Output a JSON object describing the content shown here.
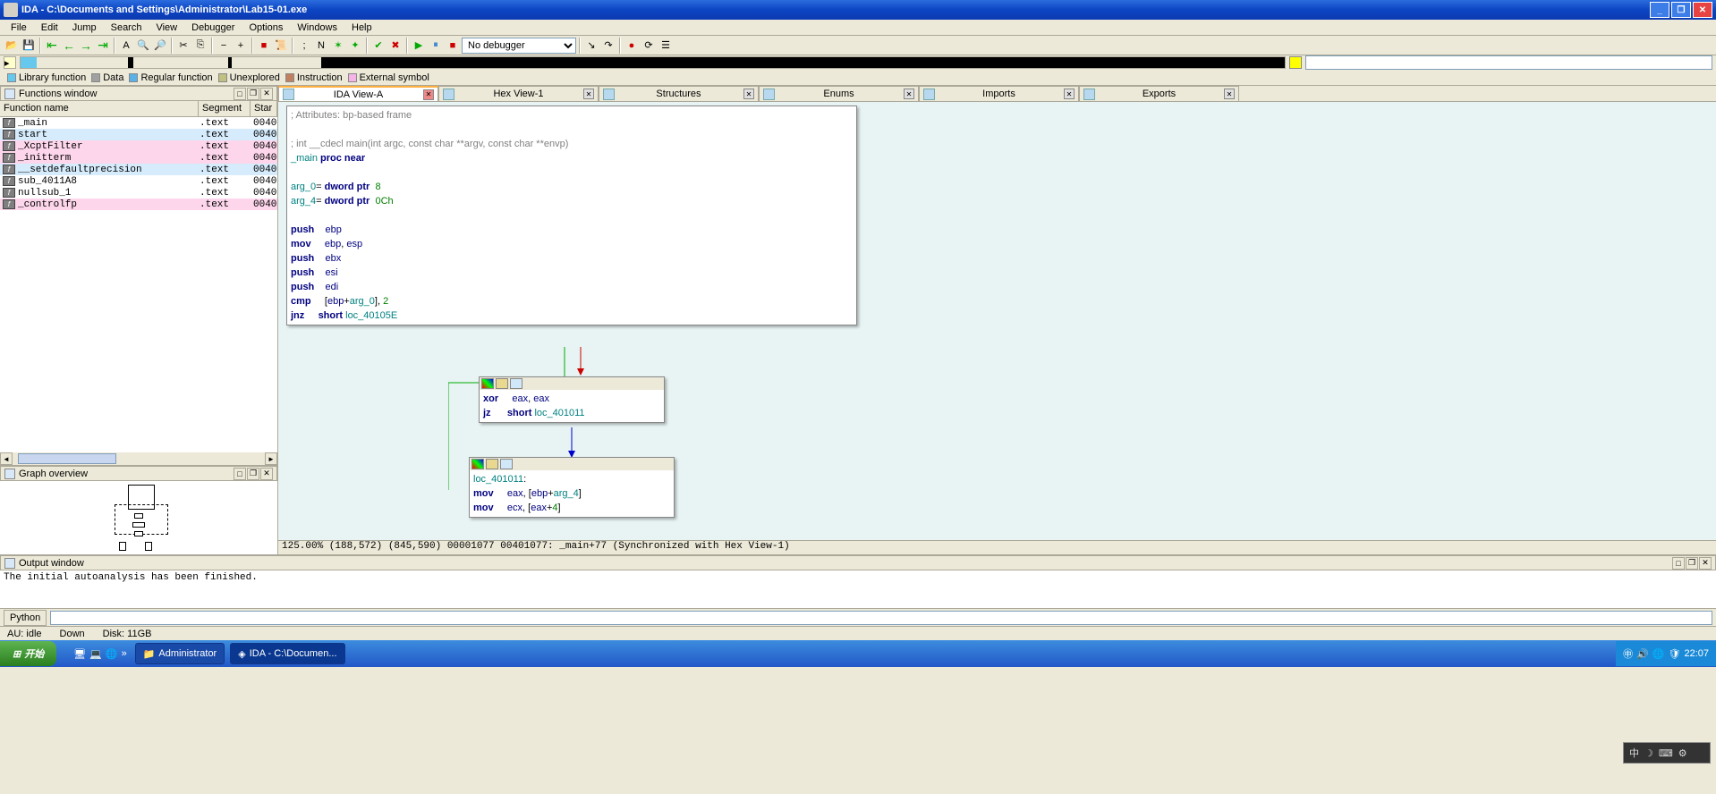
{
  "title": "IDA - C:\\Documents and Settings\\Administrator\\Lab15-01.exe",
  "menu": [
    "File",
    "Edit",
    "Jump",
    "Search",
    "View",
    "Debugger",
    "Options",
    "Windows",
    "Help"
  ],
  "debugger": "No debugger",
  "legend": [
    {
      "label": "Library function",
      "color": "#67c8ed"
    },
    {
      "label": "Data",
      "color": "#a0a0a0"
    },
    {
      "label": "Regular function",
      "color": "#5bb0e8"
    },
    {
      "label": "Unexplored",
      "color": "#c0c080"
    },
    {
      "label": "Instruction",
      "color": "#c08060"
    },
    {
      "label": "External symbol",
      "color": "#f4b4e8"
    }
  ],
  "functions_window": {
    "title": "Functions window",
    "columns": [
      "Function name",
      "Segment",
      "Star"
    ],
    "rows": [
      {
        "name": "_main",
        "seg": ".text",
        "start": "0040",
        "cls": ""
      },
      {
        "name": "start",
        "seg": ".text",
        "start": "0040",
        "cls": "blue"
      },
      {
        "name": "_XcptFilter",
        "seg": ".text",
        "start": "0040",
        "cls": "pink"
      },
      {
        "name": "_initterm",
        "seg": ".text",
        "start": "0040",
        "cls": "pink"
      },
      {
        "name": "__setdefaultprecision",
        "seg": ".text",
        "start": "0040",
        "cls": "blue"
      },
      {
        "name": "sub_4011A8",
        "seg": ".text",
        "start": "0040",
        "cls": ""
      },
      {
        "name": "nullsub_1",
        "seg": ".text",
        "start": "0040",
        "cls": ""
      },
      {
        "name": "_controlfp",
        "seg": ".text",
        "start": "0040",
        "cls": "pink"
      }
    ]
  },
  "graph_overview_title": "Graph overview",
  "tabs": [
    "IDA View-A",
    "Hex View-1",
    "Structures",
    "Enums",
    "Imports",
    "Exports"
  ],
  "node1": {
    "lines": [
      {
        "t": "; Attributes: bp-based frame",
        "c": "cmt"
      },
      {
        "t": "",
        "c": ""
      },
      {
        "t": "; int __cdecl main(int argc, const char **argv, const char **envp)",
        "c": "cmt"
      },
      {
        "parts": [
          {
            "t": "_main ",
            "c": "id"
          },
          {
            "t": "proc near",
            "c": "kw"
          }
        ]
      },
      {
        "t": "",
        "c": ""
      },
      {
        "parts": [
          {
            "t": "arg_0",
            "c": "id"
          },
          {
            "t": "= ",
            "c": ""
          },
          {
            "t": "dword ptr",
            "c": "kw"
          },
          {
            "t": "  ",
            "c": ""
          },
          {
            "t": "8",
            "c": "num"
          }
        ]
      },
      {
        "parts": [
          {
            "t": "arg_4",
            "c": "id"
          },
          {
            "t": "= ",
            "c": ""
          },
          {
            "t": "dword ptr",
            "c": "kw"
          },
          {
            "t": "  ",
            "c": ""
          },
          {
            "t": "0Ch",
            "c": "num"
          }
        ]
      },
      {
        "t": "",
        "c": ""
      },
      {
        "parts": [
          {
            "t": "push",
            "c": "kw"
          },
          {
            "t": "    ",
            "c": ""
          },
          {
            "t": "ebp",
            "c": "reg"
          }
        ]
      },
      {
        "parts": [
          {
            "t": "mov",
            "c": "kw"
          },
          {
            "t": "     ",
            "c": ""
          },
          {
            "t": "ebp",
            "c": "reg"
          },
          {
            "t": ", ",
            "c": ""
          },
          {
            "t": "esp",
            "c": "reg"
          }
        ]
      },
      {
        "parts": [
          {
            "t": "push",
            "c": "kw"
          },
          {
            "t": "    ",
            "c": ""
          },
          {
            "t": "ebx",
            "c": "reg"
          }
        ]
      },
      {
        "parts": [
          {
            "t": "push",
            "c": "kw"
          },
          {
            "t": "    ",
            "c": ""
          },
          {
            "t": "esi",
            "c": "reg"
          }
        ]
      },
      {
        "parts": [
          {
            "t": "push",
            "c": "kw"
          },
          {
            "t": "    ",
            "c": ""
          },
          {
            "t": "edi",
            "c": "reg"
          }
        ]
      },
      {
        "parts": [
          {
            "t": "cmp",
            "c": "kw"
          },
          {
            "t": "     [",
            "c": ""
          },
          {
            "t": "ebp",
            "c": "reg"
          },
          {
            "t": "+",
            "c": ""
          },
          {
            "t": "arg_0",
            "c": "id"
          },
          {
            "t": "], ",
            "c": ""
          },
          {
            "t": "2",
            "c": "num"
          }
        ]
      },
      {
        "parts": [
          {
            "t": "jnz",
            "c": "kw"
          },
          {
            "t": "     ",
            "c": ""
          },
          {
            "t": "short",
            "c": "kw"
          },
          {
            "t": " ",
            "c": ""
          },
          {
            "t": "loc_40105E",
            "c": "id"
          }
        ]
      }
    ]
  },
  "node2": {
    "lines": [
      {
        "parts": [
          {
            "t": "xor",
            "c": "kw"
          },
          {
            "t": "     ",
            "c": ""
          },
          {
            "t": "eax",
            "c": "reg"
          },
          {
            "t": ", ",
            "c": ""
          },
          {
            "t": "eax",
            "c": "reg"
          }
        ]
      },
      {
        "parts": [
          {
            "t": "jz",
            "c": "kw"
          },
          {
            "t": "      ",
            "c": ""
          },
          {
            "t": "short",
            "c": "kw"
          },
          {
            "t": " ",
            "c": ""
          },
          {
            "t": "loc_401011",
            "c": "id"
          }
        ]
      }
    ]
  },
  "node3": {
    "lines": [
      {
        "parts": [
          {
            "t": "loc_401011",
            "c": "id"
          },
          {
            "t": ":",
            "c": ""
          }
        ]
      },
      {
        "parts": [
          {
            "t": "mov",
            "c": "kw"
          },
          {
            "t": "     ",
            "c": ""
          },
          {
            "t": "eax",
            "c": "reg"
          },
          {
            "t": ", [",
            "c": ""
          },
          {
            "t": "ebp",
            "c": "reg"
          },
          {
            "t": "+",
            "c": ""
          },
          {
            "t": "arg_4",
            "c": "id"
          },
          {
            "t": "]",
            "c": ""
          }
        ]
      },
      {
        "parts": [
          {
            "t": "mov",
            "c": "kw"
          },
          {
            "t": "     ",
            "c": ""
          },
          {
            "t": "ecx",
            "c": "reg"
          },
          {
            "t": ", [",
            "c": ""
          },
          {
            "t": "eax",
            "c": "reg"
          },
          {
            "t": "+",
            "c": ""
          },
          {
            "t": "4",
            "c": "num"
          },
          {
            "t": "]",
            "c": ""
          }
        ]
      }
    ]
  },
  "graph_status": "125.00% (188,572) (845,590) 00001077 00401077: _main+77 (Synchronized with Hex View-1)",
  "output_window_title": "Output window",
  "output_text": "The initial autoanalysis has been finished.",
  "python_label": "Python",
  "status": {
    "au": "AU:  idle",
    "down": "Down",
    "disk": "Disk: 11GB"
  },
  "taskbar": {
    "start": "开始",
    "items": [
      "Administrator",
      "IDA - C:\\Documen..."
    ],
    "time": "22:07",
    "cn": "中"
  }
}
